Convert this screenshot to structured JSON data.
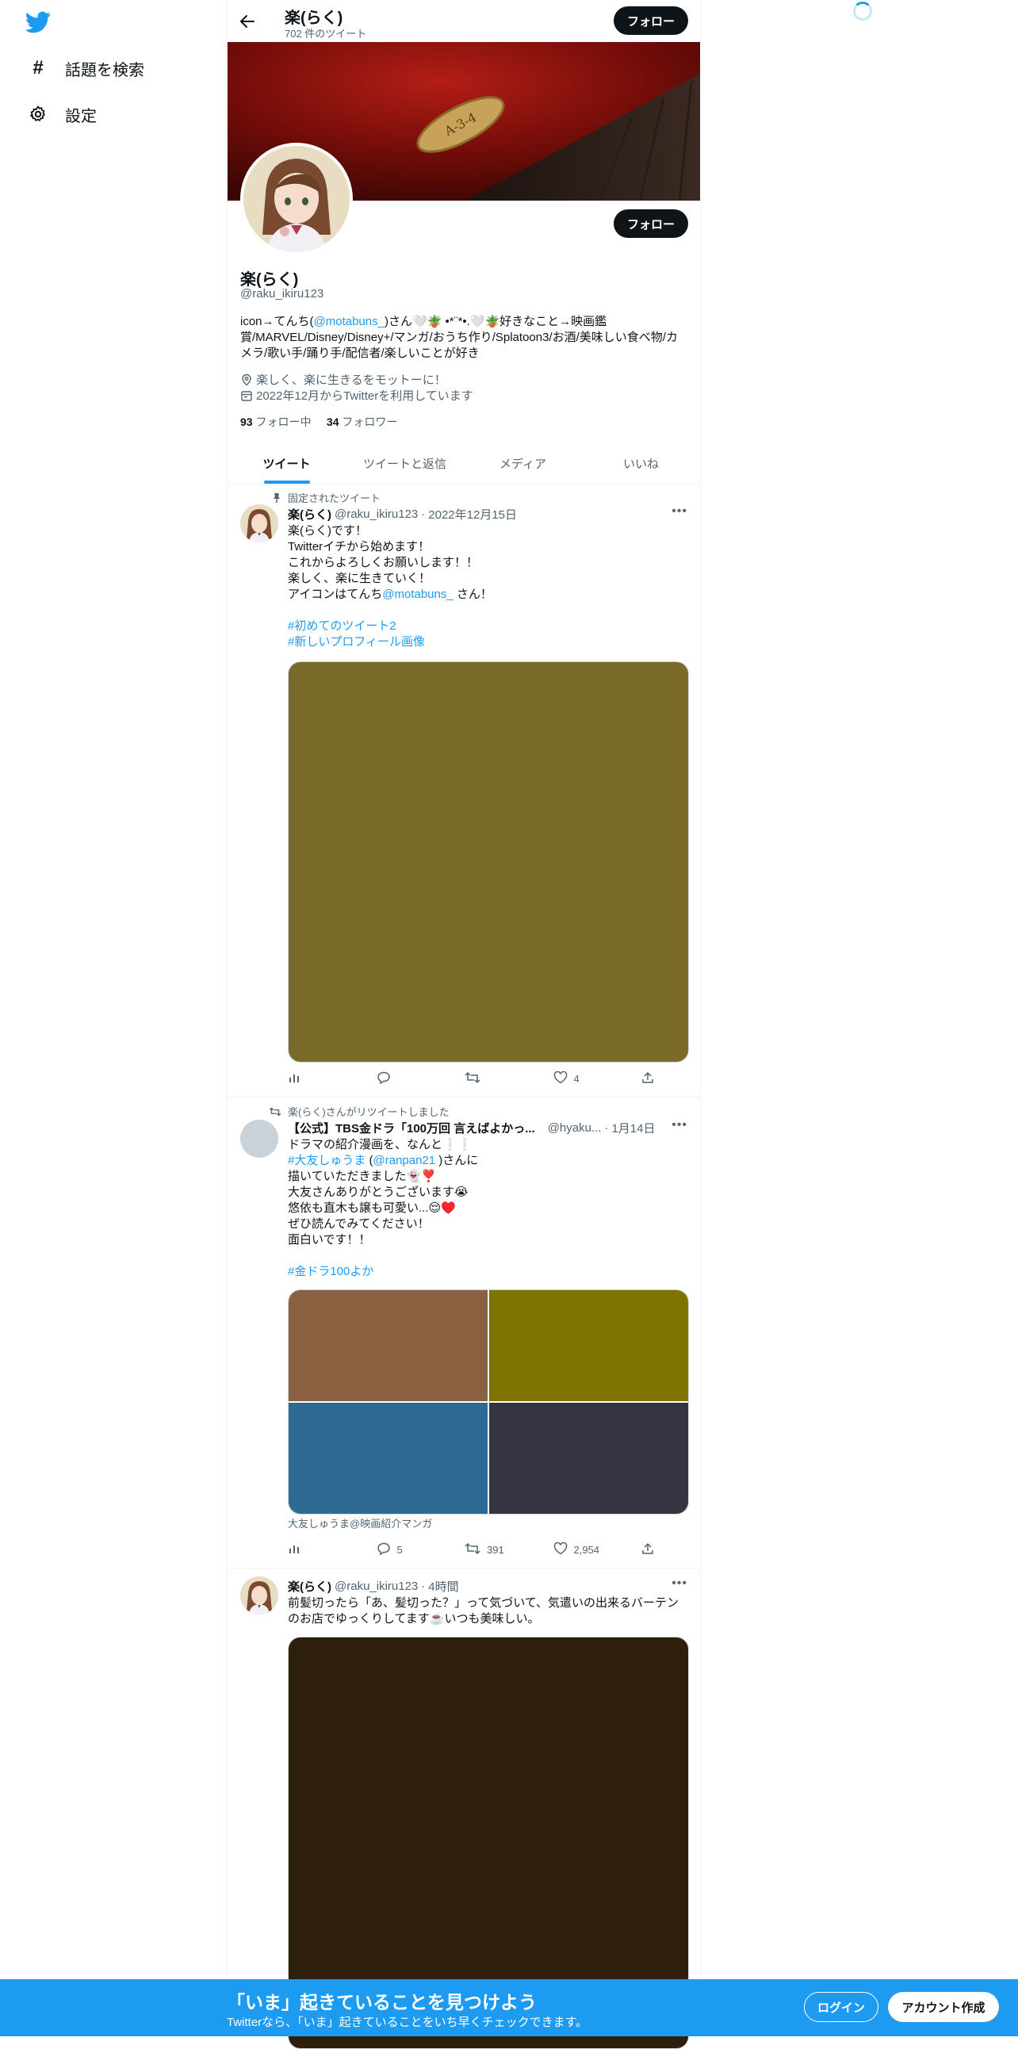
{
  "nav": {
    "items": [
      {
        "icon": "hashtag-icon",
        "label": "話題を検索"
      },
      {
        "icon": "gear-icon",
        "label": "設定"
      }
    ]
  },
  "header": {
    "name": "楽(らく)",
    "tweet_count": "702 件のツイート",
    "follow_label": "フォロー"
  },
  "banner": {
    "plate_text": "A-3-4"
  },
  "profile": {
    "name": "楽(らく)",
    "handle": "@raku_ikiru123",
    "follow_label": "フォロー",
    "bio_parts": {
      "pre": "icon→てんち(",
      "mention": "@motabuns_",
      "post": ")さん🤍🪴 •*¨*•.🤍🪴好きなこと→映画鑑賞/MARVEL/Disney/Disney+/マンガ/おうち作り/Splatoon3/お酒/美味しい食べ物/カメラ/歌い手/踊り手/配信者/楽しいことが好き"
    },
    "location": "楽しく、楽に生きるをモットーに！",
    "joined": "2022年12月からTwitterを利用しています",
    "following_count": "93",
    "following_label": "フォロー中",
    "followers_count": "34",
    "followers_label": "フォロワー"
  },
  "tabs": [
    "ツイート",
    "ツイートと返信",
    "メディア",
    "いいね"
  ],
  "tweets": [
    {
      "context": "固定されたツイート",
      "name": "楽(らく)",
      "handle": "@raku_ikiru123",
      "date": "2022年12月15日",
      "text_a": "楽(らく)です！\nTwitterイチから始めます！\nこれからよろしくお願いします！！\n楽しく、楽に生きていく！\nアイコンはてんち",
      "mention": "@motabuns_",
      "text_b": " さん！",
      "hashtags": [
        "#初めてのツイート2",
        "#新しいプロフィール画像"
      ],
      "media_color": "#7a6a2a",
      "replies": "",
      "retweets": "",
      "likes": "4"
    },
    {
      "context": "楽(らく)さんがリツイートしました",
      "name": "【公式】TBS金ドラ「100万回 言えばよかっ...",
      "handle": "@hyaku...",
      "date": "1月14日",
      "line1": "ドラマの紹介漫画を、なんと❕❕",
      "tag_inline": "#大友しゅうま",
      "inline_mid": " (",
      "mention": "@ranpan21",
      "inline_end": " )さんに",
      "text_rest": "描いていただきました👻❣️\n大友さんありがとうございます😭\n悠依も直木も譲も可愛い...😌♥️\nぜひ読んでみてください！\n面白いです！！",
      "hashtag": "#金ドラ100よか",
      "grid_colors": [
        "#8b6040",
        "#7f7300",
        "#2e6b92",
        "#373541"
      ],
      "caption": "大友しゅうま@映画紹介マンガ",
      "replies": "5",
      "retweets": "391",
      "likes": "2,954"
    },
    {
      "context": "",
      "name": "楽(らく)",
      "handle": "@raku_ikiru123",
      "date": "4時間",
      "text": "前髪切ったら「あ、髪切った？」って気づいて、気遣いの出来るバーテンのお店でゆっくりしてます☕️いつも美味しい。",
      "media_color": "#2e1f0d"
    }
  ],
  "bottom_bar": {
    "title": "「いま」起きていることを見つけよう",
    "subtitle": "Twitterなら、「いま」起きていることをいち早くチェックできます。",
    "login": "ログイン",
    "signup": "アカウント作成"
  },
  "colors": {
    "accent": "#1d9bf0",
    "text": "#0f1419",
    "muted": "#536471"
  }
}
